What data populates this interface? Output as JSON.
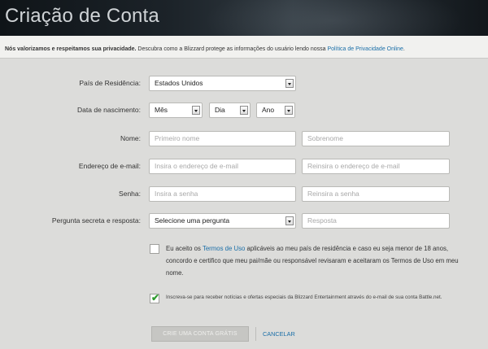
{
  "header": {
    "title": "Criação de Conta"
  },
  "privacy": {
    "bold_text": "Nós valorizamos e respeitamos sua privacidade.",
    "text": " Descubra como a Blizzard protege as informações do usuário lendo nossa ",
    "link": "Política de Privacidade Online",
    "end": "."
  },
  "form": {
    "country": {
      "label": "País de Residência:",
      "value": "Estados Unidos"
    },
    "birthdate": {
      "label": "Data de nascimento:",
      "month": "Mês",
      "day": "Dia",
      "year": "Ano"
    },
    "name": {
      "label": "Nome:",
      "first_placeholder": "Primeiro nome",
      "last_placeholder": "Sobrenome"
    },
    "email": {
      "label": "Endereço de e-mail:",
      "placeholder": "Insira o endereço de e-mail",
      "confirm_placeholder": "Reinsira o endereço de e-mail"
    },
    "password": {
      "label": "Senha:",
      "placeholder": "Insira a senha",
      "confirm_placeholder": "Reinsira a senha"
    },
    "secret": {
      "label": "Pergunta secreta e resposta:",
      "question": "Selecione uma pergunta",
      "answer_placeholder": "Resposta"
    }
  },
  "terms": {
    "checked": false,
    "before": "Eu aceito os ",
    "link": "Termos de Uso",
    "after": " aplicáveis ao meu país de residência e caso eu seja menor de 18 anos, concordo e certifico que meu pai/mãe ou responsável revisaram e aceitaram os Termos de Uso em meu nome."
  },
  "newsletter": {
    "checked": true,
    "text": "Inscreva-se para receber notícias e ofertas especiais da Blizzard Entertainment através do e-mail de sua conta Battle.net."
  },
  "actions": {
    "create_label": "CRIE UMA CONTA GRÁTIS",
    "cancel_label": "CANCELAR"
  }
}
